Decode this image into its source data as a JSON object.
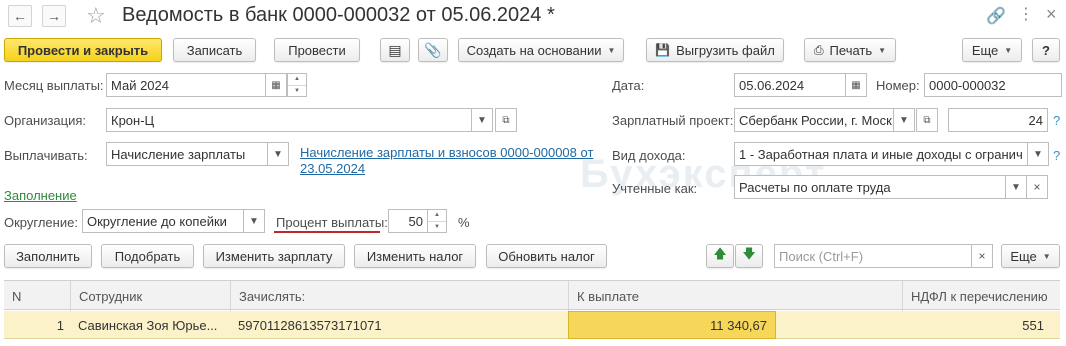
{
  "window": {
    "title": "Ведомость в банк 0000-000032 от 05.06.2024 *"
  },
  "toolbar": {
    "post_close": "Провести и закрыть",
    "save": "Записать",
    "post": "Провести",
    "create_based": "Создать на основании",
    "export_file": "Выгрузить файл",
    "print": "Печать",
    "more": "Еще",
    "help": "?"
  },
  "form": {
    "month_label": "Месяц выплаты:",
    "month_value": "Май 2024",
    "date_label": "Дата:",
    "date_value": "05.06.2024",
    "number_label": "Номер:",
    "number_value": "0000-000032",
    "org_label": "Организация:",
    "org_value": "Крон-Ц",
    "salary_project_label": "Зарплатный проект:",
    "salary_project_value": "Сбербанк России, г. Моск",
    "salary_project_count": "24",
    "pay_label": "Выплачивать:",
    "pay_value": "Начисление зарплаты",
    "pay_link": "Начисление зарплаты и взносов 0000-000008 от 23.05.2024",
    "income_type_label": "Вид дохода:",
    "income_type_value": "1 - Заработная плата и иные доходы с огранич",
    "fill_link": "Заполнение",
    "accounted_label": "Учтенные как:",
    "accounted_value": "Расчеты по оплате труда",
    "rounding_label": "Округление:",
    "rounding_value": "Округление до копейки",
    "percent_label": "Процент выплаты:",
    "percent_value": "50",
    "percent_sign": "%",
    "q": "?"
  },
  "table_toolbar": {
    "fill": "Заполнить",
    "select": "Подобрать",
    "change_salary": "Изменить зарплату",
    "change_tax": "Изменить налог",
    "update_tax": "Обновить налог",
    "search_placeholder": "Поиск (Ctrl+F)",
    "more": "Еще"
  },
  "table": {
    "columns": [
      "N",
      "Сотрудник",
      "Зачислять:",
      "К выплате",
      "НДФЛ к перечислению"
    ],
    "rows": [
      {
        "n": "1",
        "employee": "Савинская Зоя Юрье...",
        "account": "59701128613573171071",
        "to_pay": "11 340,67",
        "ndfl": "551"
      }
    ]
  },
  "watermark": "Бухэксперт",
  "colors": {
    "primary_button": "#f5d21a",
    "link": "#1f6aa5",
    "green_link": "#2e8b3a",
    "row_selected": "#fbf2c9",
    "cell_highlight": "#f6d75a",
    "underline_mark": "#c0282e"
  }
}
